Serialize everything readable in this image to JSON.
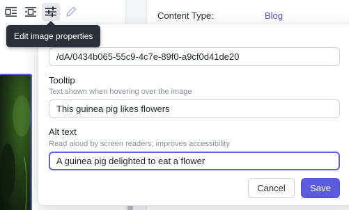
{
  "tooltip": {
    "text": "Edit image properties"
  },
  "toolbar": {
    "buttons": [
      {
        "icon": "align-left-icon"
      },
      {
        "icon": "align-center-icon"
      },
      {
        "icon": "sliders-icon",
        "active": true
      },
      {
        "icon": "pencil-icon"
      }
    ]
  },
  "sidebar": {
    "content_type_label": "Content Type:",
    "content_type_value": "Blog"
  },
  "dialog": {
    "source": {
      "value": "/dA/0434b065-55c9-4c7e-89f0-a9cf0d41de20"
    },
    "tooltip_field": {
      "label": "Tooltip",
      "help": "Text shown when hovering over the image",
      "value": "This guinea pig likes flowers"
    },
    "alt_field": {
      "label": "Alt text",
      "help": "Read aloud by screen readers; improves accessibility",
      "value": "A guinea pig delighted to eat a flower"
    },
    "cancel_label": "Cancel",
    "save_label": "Save"
  },
  "colors": {
    "accent": "#5b5be0",
    "tooltip_bg": "#2b3038",
    "link": "#4f4fd6"
  }
}
